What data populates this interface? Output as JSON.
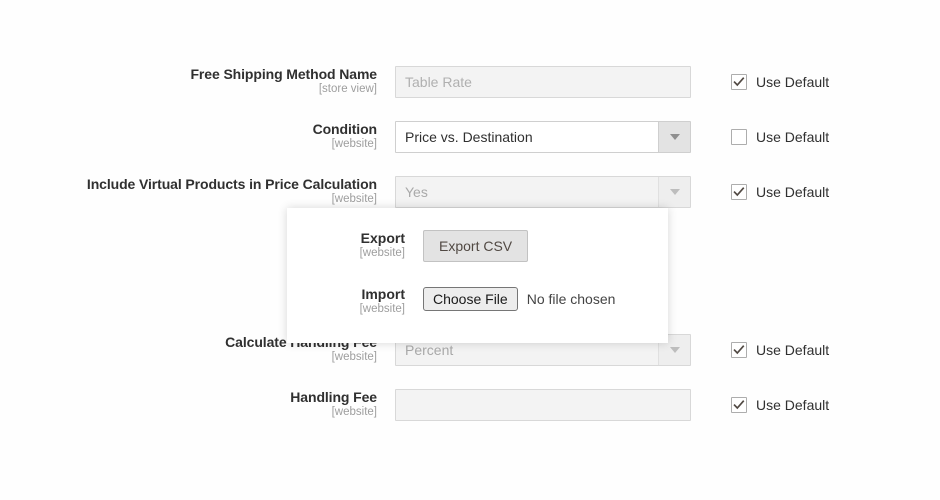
{
  "colors": {
    "page_background": "#fefefe",
    "label_text": "#303030",
    "scope_text": "#9e9e9e",
    "disabled_field_bg": "#f3f3f3",
    "select_arrow_bg": "#e3e3e3",
    "panel_bg": "#ffffff",
    "button_bg": "#e3e3e3"
  },
  "form": {
    "rows": [
      {
        "label": "Free Shipping Method Name",
        "scope": "[store view]",
        "control": "input",
        "value": "",
        "placeholder": "Table Rate",
        "disabled": true,
        "use_default_label": "Use Default",
        "use_default_checked": true
      },
      {
        "label": "Condition",
        "scope": "[website]",
        "control": "select",
        "value": "Price vs. Destination",
        "disabled": false,
        "use_default_label": "Use Default",
        "use_default_checked": false
      },
      {
        "label": "Include Virtual Products in Price Calculation",
        "scope": "[website]",
        "control": "select",
        "value": "Yes",
        "disabled": true,
        "use_default_label": "Use Default",
        "use_default_checked": true
      },
      {
        "label": "Calculate Handling Fee",
        "scope": "[website]",
        "control": "select",
        "value": "Percent",
        "disabled": true,
        "use_default_label": "Use Default",
        "use_default_checked": true
      },
      {
        "label": "Handling Fee",
        "scope": "[website]",
        "control": "input",
        "value": "",
        "placeholder": "",
        "disabled": true,
        "use_default_label": "Use Default",
        "use_default_checked": true
      }
    ]
  },
  "overlay_panel": {
    "export": {
      "label": "Export",
      "scope": "[website]",
      "button_label": "Export CSV"
    },
    "import": {
      "label": "Import",
      "scope": "[website]",
      "button_label": "Choose File",
      "file_status": "No file chosen"
    }
  }
}
